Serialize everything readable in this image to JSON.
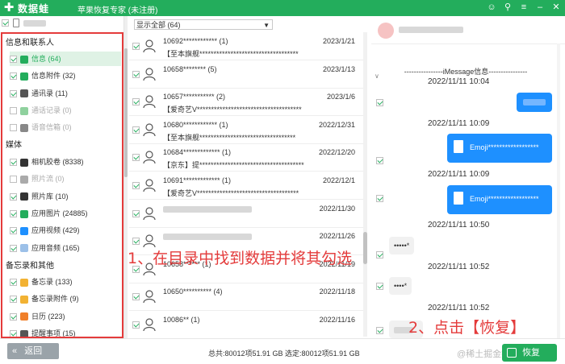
{
  "app": {
    "brand": "数据蛙",
    "title": "苹果恢复专家 (未注册)"
  },
  "sidebar": {
    "groups": [
      {
        "title": "信息和联系人",
        "items": [
          {
            "label": "信息 (64)",
            "checked": true,
            "selected": true,
            "icon_color": "#23ad5c",
            "icon": "message-icon"
          },
          {
            "label": "信息附件 (32)",
            "checked": true,
            "icon_color": "#23ad5c",
            "icon": "attachment-icon"
          },
          {
            "label": "通讯录 (11)",
            "checked": true,
            "icon_color": "#555555",
            "icon": "contacts-icon"
          },
          {
            "label": "通话记录 (0)",
            "checked": false,
            "dim": true,
            "icon_color": "#8fd19e",
            "icon": "phone-icon"
          },
          {
            "label": "语音信箱 (0)",
            "checked": false,
            "dim": true,
            "icon_color": "#888888",
            "icon": "voicemail-icon"
          }
        ]
      },
      {
        "title": "媒体",
        "items": [
          {
            "label": "相机胶卷 (8338)",
            "checked": true,
            "icon_color": "#333333",
            "icon": "camera-icon"
          },
          {
            "label": "照片流 (0)",
            "checked": false,
            "dim": true,
            "icon_color": "#aaaaaa",
            "icon": "photostream-icon"
          },
          {
            "label": "照片库 (10)",
            "checked": true,
            "icon_color": "#333333",
            "icon": "photo-library-icon"
          },
          {
            "label": "应用图片 (24885)",
            "checked": true,
            "icon_color": "#23ad5c",
            "icon": "app-photo-icon"
          },
          {
            "label": "应用视频 (429)",
            "checked": true,
            "icon_color": "#1e90ff",
            "icon": "app-video-icon"
          },
          {
            "label": "应用音频 (165)",
            "checked": true,
            "icon_color": "#9cc0e8",
            "icon": "app-audio-icon"
          }
        ]
      },
      {
        "title": "备忘录和其他",
        "items": [
          {
            "label": "备忘录 (133)",
            "checked": true,
            "icon_color": "#f2b233",
            "icon": "notes-icon"
          },
          {
            "label": "备忘录附件 (9)",
            "checked": true,
            "icon_color": "#f2b233",
            "icon": "notes-attachment-icon"
          },
          {
            "label": "日历 (223)",
            "checked": true,
            "icon_color": "#f07f2a",
            "icon": "calendar-icon"
          },
          {
            "label": "提醒事项 (15)",
            "checked": true,
            "icon_color": "#555555",
            "icon": "reminder-icon"
          }
        ]
      }
    ]
  },
  "messages": {
    "filter": "显示全部 (64)",
    "rows": [
      {
        "title": "10692************ (1)",
        "date": "2023/1/21",
        "preview": "【至本旗舰***********************************"
      },
      {
        "title": "10658******** (5)",
        "date": "2023/1/13",
        "preview": ""
      },
      {
        "title": "10657*********** (2)",
        "date": "2023/1/6",
        "preview": "【爱奇艺V*************************************"
      },
      {
        "title": "10680************ (1)",
        "date": "2022/12/31",
        "preview": "【至本旗舰**********************************"
      },
      {
        "title": "10684************* (1)",
        "date": "2022/12/20",
        "preview": "【京东】提*************************************"
      },
      {
        "title": "10691************* (1)",
        "date": "2022/12/1",
        "preview": "【爱奇艺V************************************"
      },
      {
        "title": "",
        "date": "2022/11/30",
        "preview": ""
      },
      {
        "title": "",
        "date": "2022/11/26",
        "preview": ""
      },
      {
        "title": "10658****** (1)",
        "date": "2022/11/19",
        "preview": ""
      },
      {
        "title": "10650********** (4)",
        "date": "2022/11/18",
        "preview": ""
      },
      {
        "title": "10086** (1)",
        "date": "2022/11/16",
        "preview": ""
      }
    ]
  },
  "chat": {
    "imessage_label": "----------------iMessage信息----------------",
    "entries": [
      {
        "time": "2022/11/11 10:04"
      },
      {
        "time": "2022/11/11 10:09",
        "bubble": ""
      },
      {
        "time": "2022/11/11 10:09",
        "bubble": "Emoji******************"
      },
      {
        "time": "2022/11/11 10:50",
        "bubble": "Emoji******************"
      },
      {
        "time": "2022/11/11 10:52",
        "bubble": "•••••*"
      },
      {
        "time": "2022/11/11 10:52",
        "bubble": "••••*"
      }
    ]
  },
  "footer": {
    "back_label": "返回",
    "status": "总共:80012项51.91 GB 选定:80012项51.91 GB",
    "restore_label": "恢复",
    "watermark": "@稀土掘金技术社区"
  },
  "annotations": {
    "step1": "1、在目录中找到数据并将其勾选",
    "step2": "2、点击【恢复】"
  },
  "colors": {
    "brand_green": "#23ad5c",
    "annotation_red": "#e43b3b",
    "bubble_blue": "#1e90ff"
  }
}
